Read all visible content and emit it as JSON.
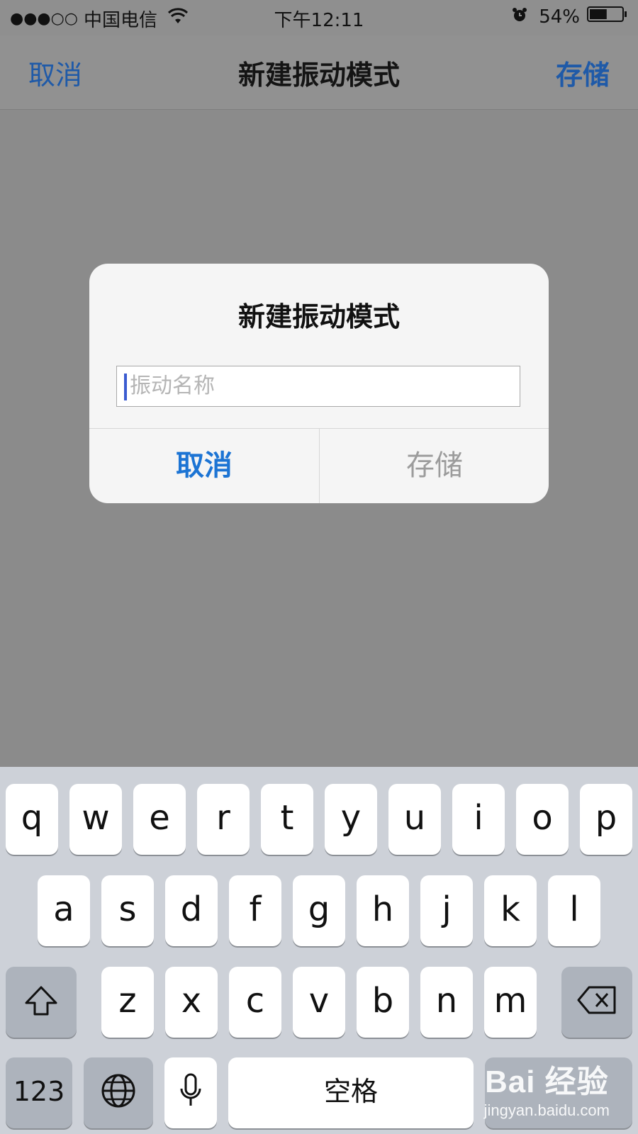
{
  "status_bar": {
    "signal": "●●●○○",
    "carrier": "中国电信",
    "time": "下午12:11",
    "battery_percent": "54%",
    "battery_level": 0.54,
    "icons": [
      "wifi-icon",
      "alarm-icon",
      "battery-icon"
    ]
  },
  "nav": {
    "cancel_label": "取消",
    "title": "新建振动模式",
    "save_label": "存储"
  },
  "alert": {
    "title": "新建振动模式",
    "input_placeholder": "振动名称",
    "input_value": "",
    "cancel_label": "取消",
    "save_label": "存储"
  },
  "keyboard": {
    "row1": [
      "q",
      "w",
      "e",
      "r",
      "t",
      "y",
      "u",
      "i",
      "o",
      "p"
    ],
    "row2": [
      "a",
      "s",
      "d",
      "f",
      "g",
      "h",
      "j",
      "k",
      "l"
    ],
    "row3": [
      "z",
      "x",
      "c",
      "v",
      "b",
      "n",
      "m"
    ],
    "numbers_label": "123",
    "space_label": "空格",
    "return_label": "",
    "icons": [
      "shift-icon",
      "backspace-icon",
      "globe-icon",
      "microphone-icon"
    ]
  },
  "watermark": {
    "logo": "Bai 经验",
    "url": "jingyan.baidu.com"
  },
  "colors": {
    "accent": "#1c74d4",
    "nav_accent": "#1f5aa8",
    "dim_background": "#8d8d8d",
    "keyboard_background": "#cdd1d8"
  }
}
